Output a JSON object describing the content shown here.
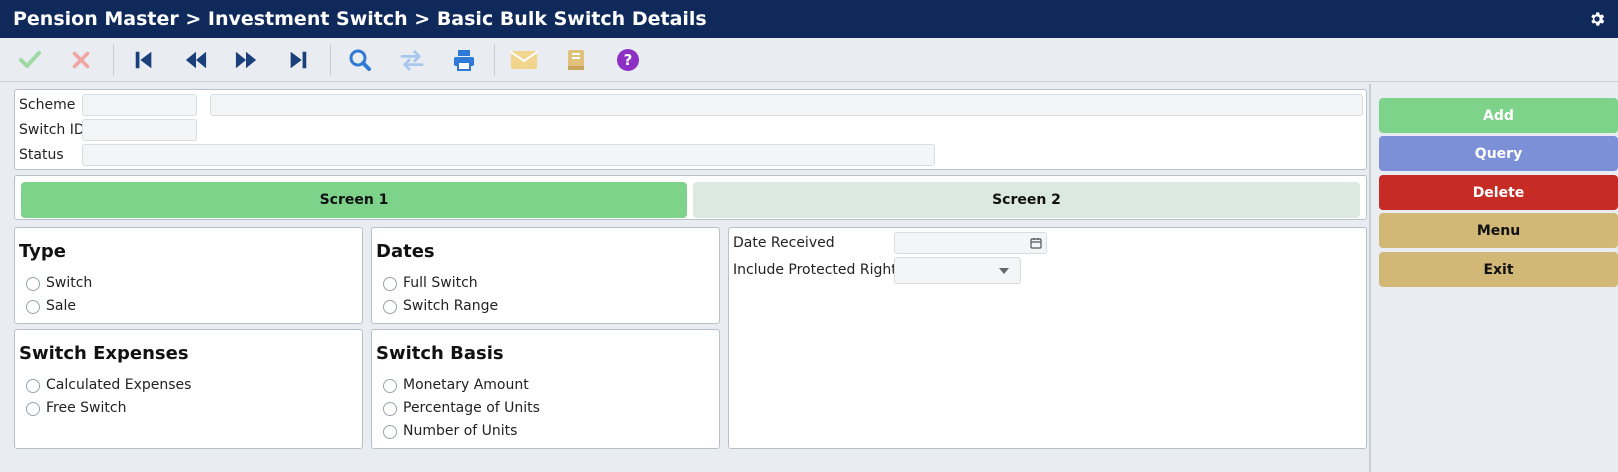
{
  "titlebar": {
    "title": "Pension Master > Investment Switch > Basic Bulk Switch Details",
    "settings_icon": "gear-icon"
  },
  "toolbar": {
    "icons": [
      "check-icon",
      "cancel-icon",
      "first-record-icon",
      "previous-record-icon",
      "next-record-icon",
      "last-record-icon",
      "search-icon",
      "switch-icon",
      "print-icon",
      "mail-icon",
      "book-icon",
      "help-icon"
    ]
  },
  "header": {
    "scheme_label": "Scheme",
    "switch_id_label": "Switch ID",
    "status_label": "Status",
    "scheme_code": "",
    "scheme_name": "",
    "switch_id": "",
    "status": ""
  },
  "tabs": [
    {
      "label": "Screen 1",
      "active": true
    },
    {
      "label": "Screen 2",
      "active": false
    }
  ],
  "type": {
    "heading": "Type",
    "options": [
      "Switch",
      "Sale"
    ]
  },
  "dates": {
    "heading": "Dates",
    "options": [
      "Full Switch",
      "Switch Range"
    ]
  },
  "expenses": {
    "heading": "Switch Expenses",
    "options": [
      "Calculated Expenses",
      "Free Switch"
    ]
  },
  "basis": {
    "heading": "Switch Basis",
    "options": [
      "Monetary Amount",
      "Percentage of Units",
      "Number of Units"
    ]
  },
  "details": {
    "date_received_label": "Date Received",
    "date_received": "",
    "protected_rights_label": "Include Protected Rights",
    "protected_rights": ""
  },
  "side_buttons": [
    {
      "label": "Add",
      "color": "#7dd38a"
    },
    {
      "label": "Query",
      "color": "#7b90d6"
    },
    {
      "label": "Delete",
      "color": "#c62b25"
    },
    {
      "label": "Menu",
      "color": "#d2b877"
    },
    {
      "label": "Exit",
      "color": "#d2b877"
    }
  ]
}
